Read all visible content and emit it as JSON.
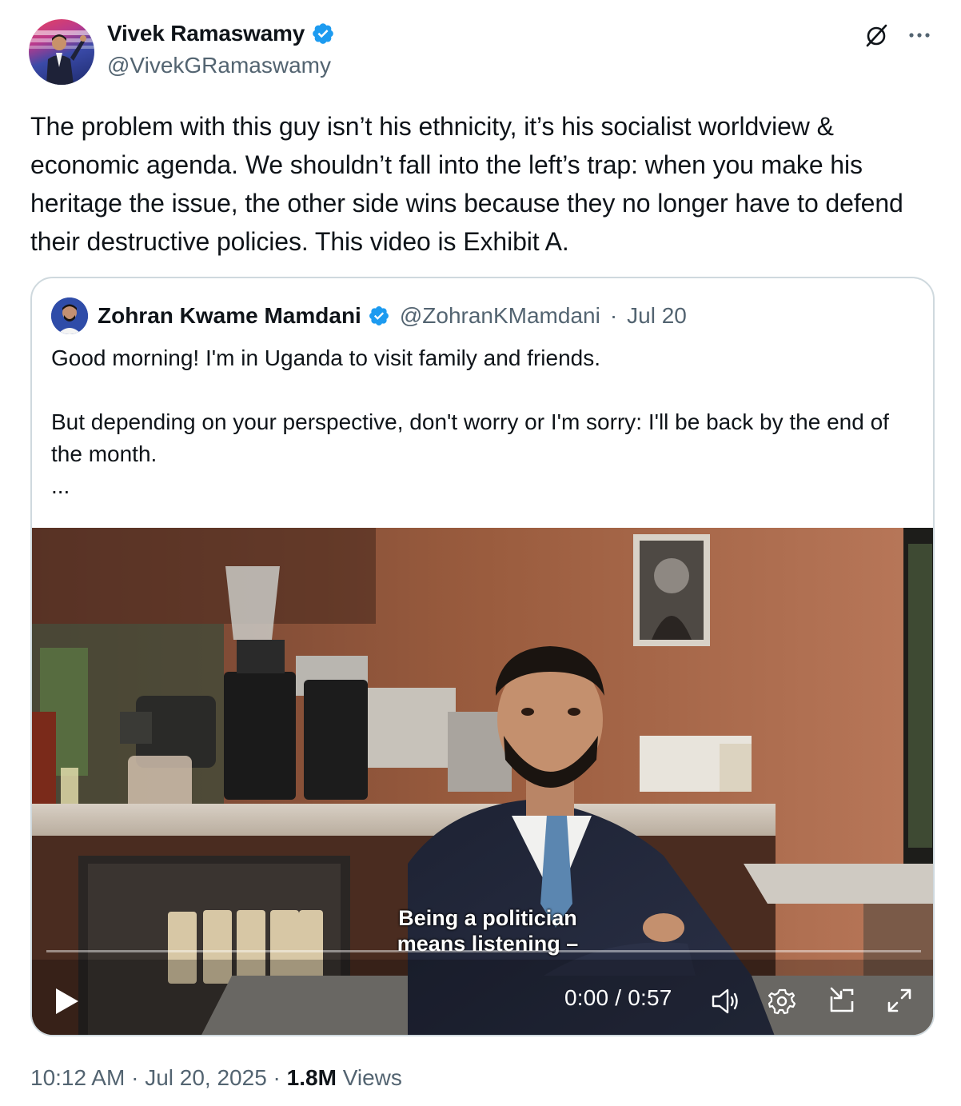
{
  "author": {
    "name": "Vivek Ramaswamy",
    "handle": "@VivekGRamaswamy"
  },
  "tweet": {
    "text": "The problem with this guy isn’t his ethnicity, it’s his socialist worldview & economic agenda. We shouldn’t fall into the left’s trap: when you make his heritage the issue, the other side wins because they no longer have to defend their destructive policies. This video is Exhibit A."
  },
  "quoted": {
    "name": "Zohran Kwame Mamdani",
    "handle": "@ZohranKMamdani",
    "separator": "·",
    "date": "Jul 20",
    "text": "Good morning! I'm in Uganda to visit family and friends.\n\nBut depending on your perspective, don't worry or I'm sorry: I'll be back by the end of the month.\n...",
    "video": {
      "caption_line1": "Being a politician",
      "caption_line2": "means listening –",
      "time": "0:00 / 0:57",
      "progress": 0
    }
  },
  "footer": {
    "time": "10:12 AM",
    "sep1": " · ",
    "date": "Jul 20, 2025",
    "sep2": " · ",
    "views_count": "1.8M",
    "views_label": " Views"
  },
  "colors": {
    "verified": "#1d9bf0",
    "secondary_text": "#536471",
    "border": "#cfd9de"
  },
  "icons": [
    "verified-badge-icon",
    "grok-icon",
    "more-icon",
    "play-icon",
    "volume-icon",
    "settings-icon",
    "pip-icon",
    "fullscreen-icon"
  ]
}
